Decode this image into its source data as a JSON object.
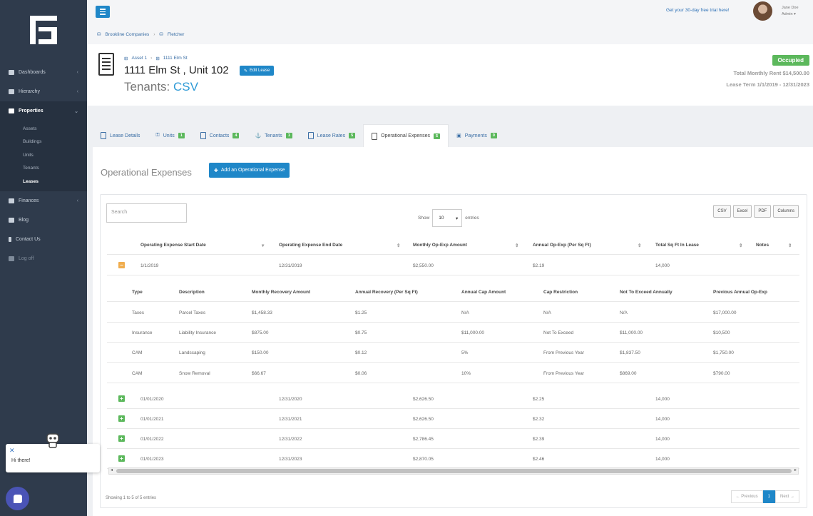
{
  "sidebar": {
    "items": [
      {
        "label": "Dashboards"
      },
      {
        "label": "Hierarchy"
      },
      {
        "label": "Properties"
      },
      {
        "label": "Finances"
      },
      {
        "label": "Blog"
      },
      {
        "label": "Contact Us"
      },
      {
        "label": "Log off"
      }
    ],
    "sub_items": [
      {
        "label": "Assets"
      },
      {
        "label": "Buildings"
      },
      {
        "label": "Units"
      },
      {
        "label": "Tenants"
      },
      {
        "label": "Leases"
      }
    ]
  },
  "chat": {
    "greeting": "Hi there!",
    "close": "✕"
  },
  "topbar": {
    "trial": "Get your 30-day free trial here!",
    "user_name": "Jane Doe",
    "user_role": "Admin ▾",
    "breadcrumb": [
      "Brookline Companies",
      "Fletcher"
    ]
  },
  "header": {
    "breadcrumb": [
      "Asset 1",
      "1111 Elm St"
    ],
    "title": "1111 Elm St , Unit 102",
    "edit_label": "Edit Lease",
    "tenants_label": "Tenants:",
    "tenants_value": "CSV",
    "status": "Occupied",
    "rent": "Total Monthly Rent $14,500.00",
    "term": "Lease Term 1/1/2019 - 12/31/2023"
  },
  "tabs": [
    {
      "label": "Lease Details",
      "badge": ""
    },
    {
      "label": "Units",
      "badge": "1"
    },
    {
      "label": "Contacts",
      "badge": "4"
    },
    {
      "label": "Tenants",
      "badge": "1"
    },
    {
      "label": "Lease Rates",
      "badge": "5"
    },
    {
      "label": "Operational Expenses",
      "badge": "5"
    },
    {
      "label": "Payments",
      "badge": "0"
    }
  ],
  "section": {
    "title": "Operational Expenses",
    "add_label": "Add an Operational Expense"
  },
  "table": {
    "search_placeholder": "Search",
    "show_label": "Show",
    "page_size": "10",
    "entries_label": "entries",
    "export_buttons": [
      "CSV",
      "Excel",
      "PDF",
      "Columns"
    ],
    "columns": [
      "Operating Expense Start Date",
      "Operating Expense End Date",
      "Monthly Op-Exp Amount",
      "Annual Op-Exp (Per Sq Ft)",
      "Total Sq Ft In Lease",
      "Notes"
    ],
    "rows": [
      {
        "start": "1/1/2019",
        "end": "12/31/2019",
        "monthly": "$2,550.00",
        "annual": "$2.19",
        "sqft": "14,000",
        "expanded": true
      },
      {
        "start": "01/01/2020",
        "end": "12/31/2020",
        "monthly": "$2,626.50",
        "annual": "$2.25",
        "sqft": "14,000",
        "expanded": false
      },
      {
        "start": "01/01/2021",
        "end": "12/31/2021",
        "monthly": "$2,626.50",
        "annual": "$2.32",
        "sqft": "14,000",
        "expanded": false
      },
      {
        "start": "01/01/2022",
        "end": "12/31/2022",
        "monthly": "$2,786.45",
        "annual": "$2.39",
        "sqft": "14,000",
        "expanded": false
      },
      {
        "start": "01/01/2023",
        "end": "12/31/2023",
        "monthly": "$2,870.05",
        "annual": "$2.46",
        "sqft": "14,000",
        "expanded": false
      }
    ],
    "detail_columns": [
      "Type",
      "Description",
      "Monthly Recovery Amount",
      "Annual Recovery (Per Sq Ft)",
      "Annual Cap Amount",
      "Cap Restriction",
      "Not To Exceed Annually",
      "Previous Annual Op-Exp"
    ],
    "detail_rows": [
      [
        "Taxes",
        "Parcel Taxes",
        "$1,458.33",
        "$1.25",
        "N/A",
        "N/A",
        "N/A",
        "$17,000.00"
      ],
      [
        "Insurance",
        "Liability Insurance",
        "$875.00",
        "$0.75",
        "$11,000.00",
        "Not To Exceed",
        "$11,000.00",
        "$10,500"
      ],
      [
        "CAM",
        "Landscaping",
        "$150.00",
        "$0.12",
        "5%",
        "From Previous Year",
        "$1,837.50",
        "$1,750.00"
      ],
      [
        "CAM",
        "Snow Removal",
        "$66.67",
        "$0.06",
        "10%",
        "From Previous Year",
        "$869.00",
        "$790.00"
      ]
    ],
    "info": "Showing 1 to 5 of 5 entries",
    "pager": {
      "prev": "← Previous",
      "page": "1",
      "next": "Next →"
    }
  }
}
